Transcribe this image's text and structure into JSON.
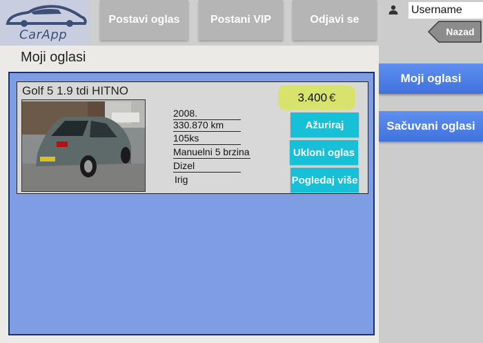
{
  "logo": {
    "text": "CarApp"
  },
  "nav": {
    "post_ad": "Postavi oglas",
    "become_vip": "Postani VIP",
    "logout": "Odjavi se"
  },
  "user": {
    "username": "Username"
  },
  "back_label": "Nazad",
  "sidebar": {
    "my_ads": "Moji oglasi",
    "saved_ads": "Sačuvani oglasi"
  },
  "page": {
    "title": "Moji oglasi"
  },
  "ad": {
    "title": "Golf 5 1.9 tdi HITNO",
    "price": "3.400",
    "currency": "€",
    "specs": [
      "2008.",
      "330.870 km",
      "105ks",
      "Manuelni 5 brzina",
      "Dizel",
      "Irig"
    ],
    "actions": {
      "update": "Ažuriraj",
      "remove": "Ukloni oglas",
      "view_more": "Pogledaj više"
    }
  },
  "colors": {
    "nav_button": "#b5b5b5",
    "side_button": "#4a7de6",
    "ads_background": "#7e9de3",
    "price_badge": "#d7e36b",
    "action_button": "#17c0d6"
  },
  "icons": {
    "logo": "car-logo-icon",
    "user": "person-icon",
    "back": "back-arrow-icon"
  }
}
